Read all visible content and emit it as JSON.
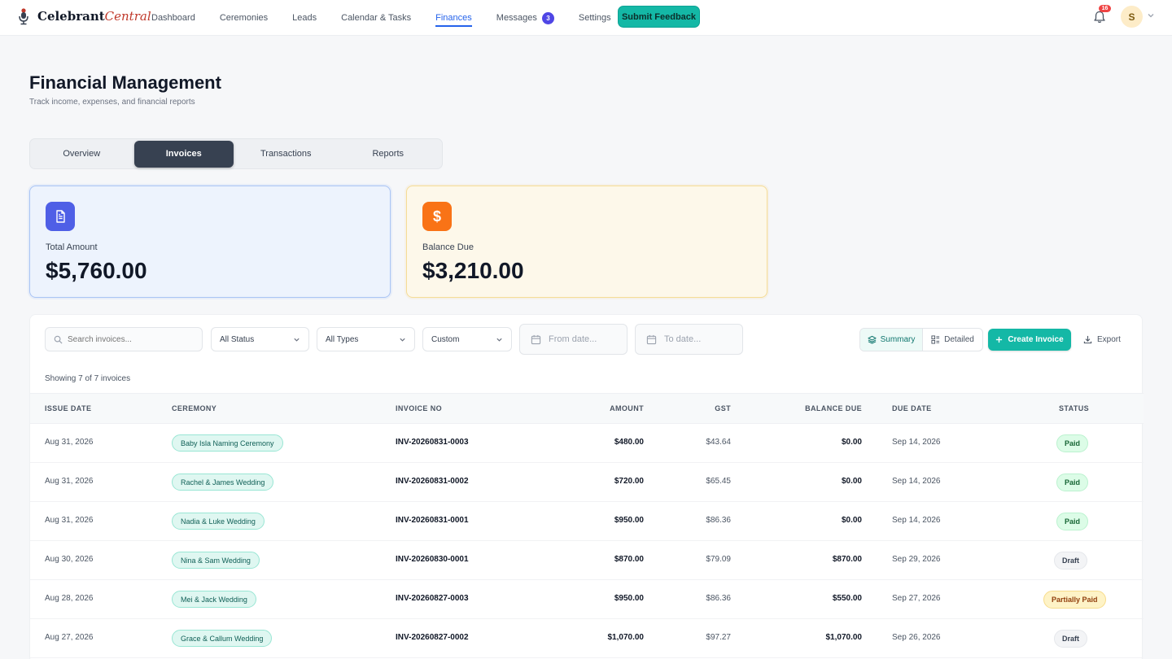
{
  "nav": {
    "brand_main": "Celebrant",
    "brand_accent": "Central",
    "links": [
      {
        "label": "Dashboard"
      },
      {
        "label": "Ceremonies"
      },
      {
        "label": "Leads"
      },
      {
        "label": "Calendar & Tasks"
      },
      {
        "label": "Finances"
      },
      {
        "label": "Messages",
        "badge": "3"
      },
      {
        "label": "Settings"
      }
    ],
    "active": "Finances",
    "feedback_label": "Submit Feedback",
    "notification_count": "16",
    "avatar_initial": "S"
  },
  "header": {
    "title": "Financial Management",
    "subtitle": "Track income, expenses, and financial reports"
  },
  "tabs": [
    {
      "label": "Overview"
    },
    {
      "label": "Invoices"
    },
    {
      "label": "Transactions"
    },
    {
      "label": "Reports"
    }
  ],
  "active_tab": "Invoices",
  "cards": {
    "total": {
      "label": "Total Amount",
      "value": "$5,760.00",
      "icon": "document-icon"
    },
    "balance": {
      "label": "Balance Due",
      "value": "$3,210.00",
      "icon": "dollar-icon",
      "symbol": "$"
    }
  },
  "filters": {
    "search_placeholder": "Search invoices...",
    "status": "All Status",
    "types": "All Types",
    "range": "Custom",
    "from_placeholder": "From date...",
    "to_placeholder": "To date...",
    "summary_label": "Summary",
    "detailed_label": "Detailed",
    "create_label": "Create Invoice",
    "export_label": "Export"
  },
  "showing": "Showing 7 of 7 invoices",
  "table": {
    "columns": [
      "ISSUE DATE",
      "CEREMONY",
      "INVOICE NO",
      "AMOUNT",
      "GST",
      "BALANCE DUE",
      "DUE DATE",
      "STATUS"
    ],
    "rows": [
      {
        "issue_date": "Aug 31, 2026",
        "ceremony": "Baby Isla Naming Ceremony",
        "invoice_no": "INV-20260831-0003",
        "amount": "$480.00",
        "gst": "$43.64",
        "balance_due": "$0.00",
        "due_date": "Sep 14, 2026",
        "status": "Paid"
      },
      {
        "issue_date": "Aug 31, 2026",
        "ceremony": "Rachel & James Wedding",
        "invoice_no": "INV-20260831-0002",
        "amount": "$720.00",
        "gst": "$65.45",
        "balance_due": "$0.00",
        "due_date": "Sep 14, 2026",
        "status": "Paid"
      },
      {
        "issue_date": "Aug 31, 2026",
        "ceremony": "Nadia & Luke Wedding",
        "invoice_no": "INV-20260831-0001",
        "amount": "$950.00",
        "gst": "$86.36",
        "balance_due": "$0.00",
        "due_date": "Sep 14, 2026",
        "status": "Paid"
      },
      {
        "issue_date": "Aug 30, 2026",
        "ceremony": "Nina & Sam Wedding",
        "invoice_no": "INV-20260830-0001",
        "amount": "$870.00",
        "gst": "$79.09",
        "balance_due": "$870.00",
        "due_date": "Sep 29, 2026",
        "status": "Draft"
      },
      {
        "issue_date": "Aug 28, 2026",
        "ceremony": "Mei & Jack Wedding",
        "invoice_no": "INV-20260827-0003",
        "amount": "$950.00",
        "gst": "$86.36",
        "balance_due": "$550.00",
        "due_date": "Sep 27, 2026",
        "status": "Partially Paid"
      },
      {
        "issue_date": "Aug 27, 2026",
        "ceremony": "Grace & Callum Wedding",
        "invoice_no": "INV-20260827-0002",
        "amount": "$1,070.00",
        "gst": "$97.27",
        "balance_due": "$1,070.00",
        "due_date": "Sep 26, 2026",
        "status": "Draft"
      }
    ]
  },
  "colors": {
    "accent_teal": "#14b8a6",
    "active_blue": "#2563eb",
    "paid": "#dcfce7",
    "draft": "#f3f4f6",
    "partial": "#fef3c7"
  }
}
